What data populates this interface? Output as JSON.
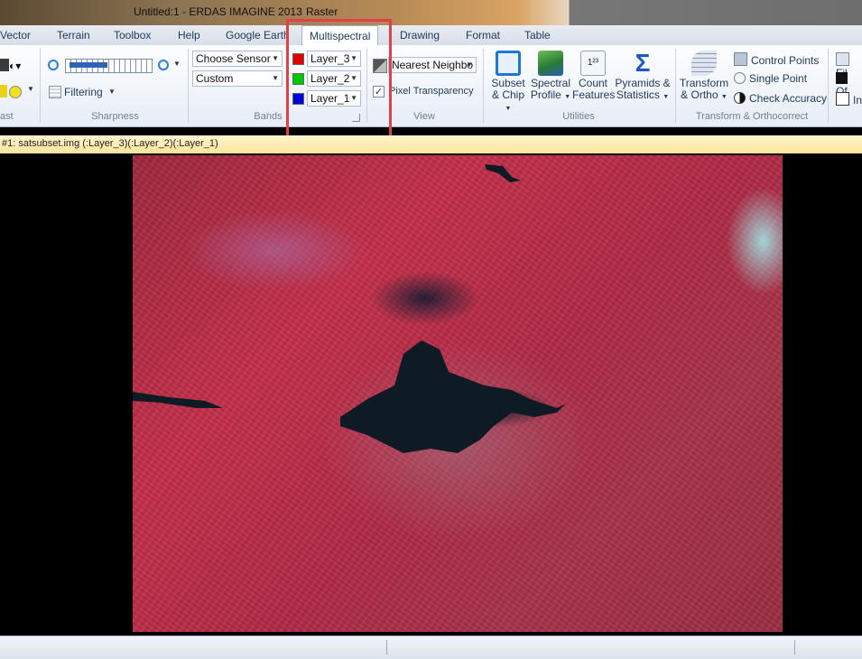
{
  "window": {
    "title": "Untitled:1 - ERDAS IMAGINE 2013",
    "context_tab": "Raster"
  },
  "tabs": [
    {
      "label": "Vector"
    },
    {
      "label": "Terrain"
    },
    {
      "label": "Toolbox"
    },
    {
      "label": "Help"
    },
    {
      "label": "Google Earth"
    },
    {
      "label": "Multispectral",
      "active": true
    },
    {
      "label": "Drawing"
    },
    {
      "label": "Format"
    },
    {
      "label": "Table"
    }
  ],
  "ribbon": {
    "contrast_group": {
      "label": "ast"
    },
    "sharpness_group": {
      "label": "Sharpness",
      "filtering_label": "Filtering"
    },
    "bands_group": {
      "label": "Bands",
      "sensor_value": "Choose Sensor",
      "preset_value": "Custom",
      "red_layer": "Layer_3",
      "green_layer": "Layer_2",
      "blue_layer": "Layer_1",
      "red_color": "#e00000",
      "green_color": "#00c800",
      "blue_color": "#0000d8"
    },
    "view_group": {
      "label": "View",
      "resample_value": "Nearest Neighbo",
      "pixel_transparency_label": "Pixel Transparency",
      "pixel_transparency_checked": true
    },
    "utilities_group": {
      "label": "Utilities",
      "subset_label1": "Subset",
      "subset_label2": "& Chip",
      "spectral_label1": "Spectral",
      "spectral_label2": "Profile",
      "count_label1": "Count",
      "count_label2": "Features",
      "pyramids_label1": "Pyramids &",
      "pyramids_label2": "Statistics"
    },
    "transform_group": {
      "label": "Transform & Orthocorrect",
      "transform_label1": "Transform",
      "transform_label2": "& Ortho",
      "control_points": "Control Points",
      "single_point": "Single Point",
      "check_accuracy": "Check Accuracy"
    },
    "right_group": {
      "item1": "Fil",
      "item2": "Of",
      "item3": "In"
    }
  },
  "viewer": {
    "path_text": "#1: satsubset.img (:Layer_3)(:Layer_2)(:Layer_1)"
  }
}
